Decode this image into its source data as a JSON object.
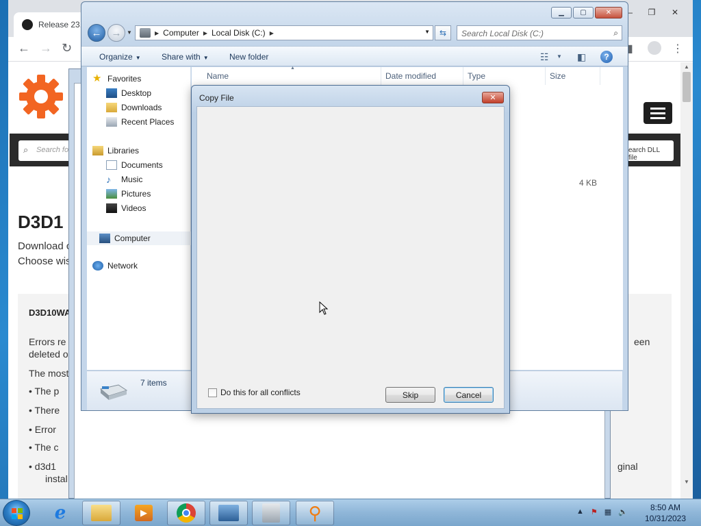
{
  "chrome": {
    "tab_title": "Release 23."
  },
  "site": {
    "search_placeholder": "Search for",
    "search_button": "earch DLL file",
    "title": "D3D1",
    "sub_line1": "Download c",
    "sub_line2": "Choose wis",
    "box_title": "D3D10WA",
    "box_lines": [
      "Errors re",
      "deleted o",
      "The most"
    ],
    "bullets": [
      "The p",
      "There",
      "Error",
      "The c",
      "d3d1",
      "instal"
    ],
    "right_fragments": [
      "een",
      "ginal"
    ]
  },
  "explorer": {
    "breadcrumb": [
      "Computer",
      "Local Disk (C:)"
    ],
    "search_placeholder": "Search Local Disk (C:)",
    "toolbar": {
      "organize": "Organize",
      "share_with": "Share with",
      "new_folder": "New folder"
    },
    "nav": {
      "favorites": "Favorites",
      "favorite_items": [
        "Desktop",
        "Downloads",
        "Recent Places"
      ],
      "libraries": "Libraries",
      "library_items": [
        "Documents",
        "Music",
        "Pictures",
        "Videos"
      ],
      "computer": "Computer",
      "network": "Network"
    },
    "columns": [
      "Name",
      "Date modified",
      "Type",
      "Size"
    ],
    "size_value": "4 KB",
    "item_count": "7 items"
  },
  "dialog": {
    "title": "Copy File",
    "checkbox_label": "Do this for all conflicts",
    "skip": "Skip",
    "cancel": "Cancel"
  },
  "taskbar": {
    "time": "8:50 AM",
    "date": "10/31/2023"
  }
}
